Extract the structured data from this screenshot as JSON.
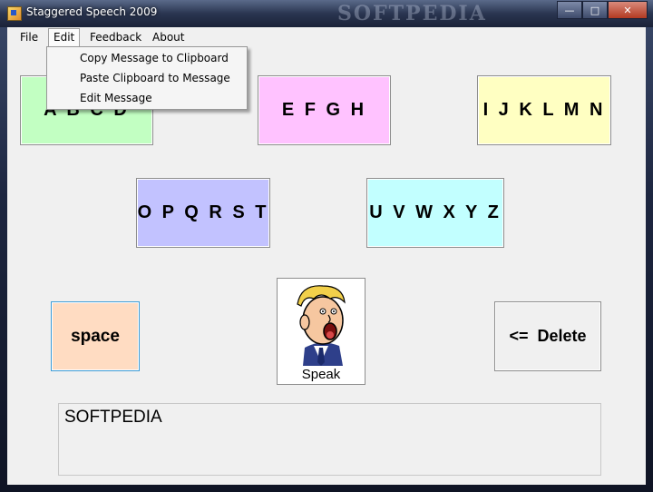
{
  "window": {
    "title": "Staggered Speech 2009",
    "watermark": "SOFTPEDIA",
    "minimize_glyph": "—",
    "maximize_glyph": "□",
    "close_glyph": "✕"
  },
  "menu": {
    "file": "File",
    "edit": "Edit",
    "feedback": "Feedback",
    "about": "About"
  },
  "edit_menu": {
    "items": [
      "Copy Message to Clipboard",
      "Paste Clipboard to Message",
      "Edit Message"
    ]
  },
  "letter_buttons": {
    "abcd": {
      "label": "A B C D",
      "color": "#c2ffc2"
    },
    "efgh": {
      "label": "E F G H",
      "color": "#ffc2ff"
    },
    "ijklmn": {
      "label": "I J K L M N",
      "color": "#ffffc2"
    },
    "opqrst": {
      "label": "O P Q R S T",
      "color": "#c2c2ff"
    },
    "uvwxyz": {
      "label": "U V W X Y Z",
      "color": "#c2ffff"
    }
  },
  "space_button": {
    "label": "space",
    "color": "#ffdcc2"
  },
  "delete_button": {
    "label": "<=  Delete"
  },
  "speak_button": {
    "label": "Speak",
    "icon": "shouting-man-icon"
  },
  "message": {
    "text": "SOFTPEDIA"
  }
}
